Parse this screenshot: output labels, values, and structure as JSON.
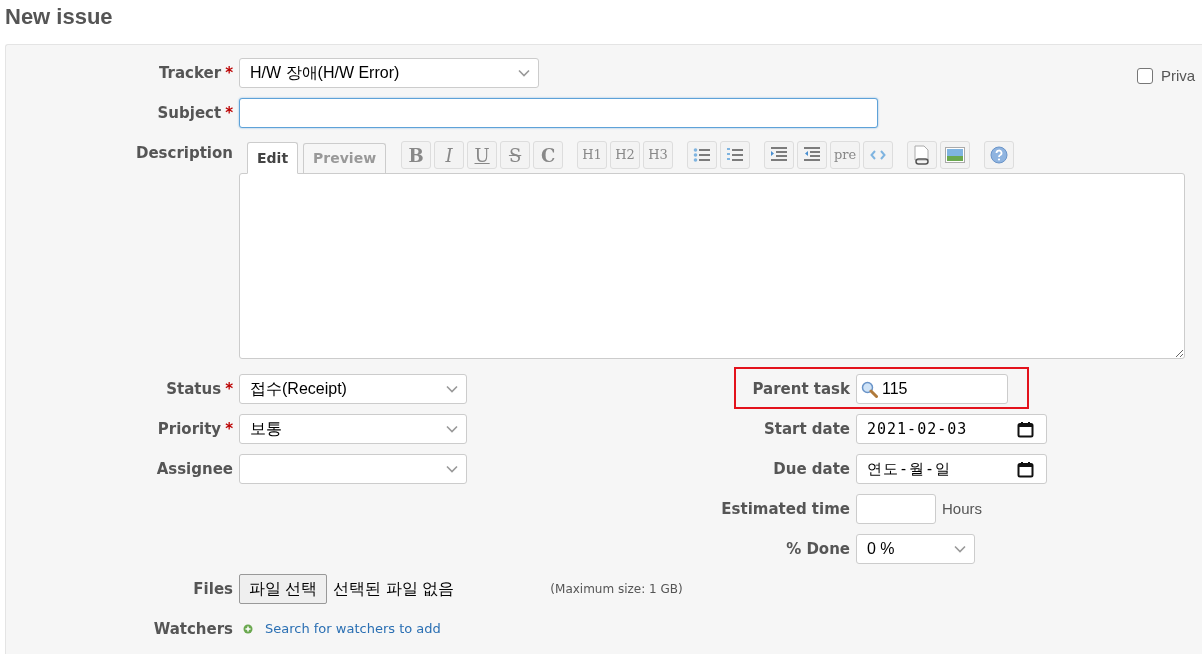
{
  "page_title": "New issue",
  "private": {
    "label": "Priva",
    "checked": false
  },
  "tracker": {
    "label": "Tracker",
    "required_mark": "*",
    "value": "H/W 장애(H/W Error)"
  },
  "subject": {
    "label": "Subject",
    "required_mark": "*",
    "focused": true
  },
  "description": {
    "label": "Description",
    "tabs": [
      {
        "label": "Edit",
        "selected": true
      },
      {
        "label": "Preview",
        "selected": false
      }
    ],
    "toolbar": [
      [
        {
          "kind": "text",
          "label": "B"
        },
        {
          "kind": "text",
          "label": "I"
        },
        {
          "kind": "text",
          "label": "U"
        },
        {
          "kind": "text",
          "label": "S"
        },
        {
          "kind": "text",
          "label": "C"
        }
      ],
      [
        {
          "kind": "text",
          "label": "H1"
        },
        {
          "kind": "text",
          "label": "H2"
        },
        {
          "kind": "text",
          "label": "H3"
        }
      ],
      [
        {
          "kind": "ul"
        },
        {
          "kind": "ol"
        }
      ],
      [
        {
          "kind": "indent"
        },
        {
          "kind": "outdent"
        },
        {
          "kind": "text",
          "label": "pre"
        },
        {
          "kind": "code"
        }
      ],
      [
        {
          "kind": "link"
        },
        {
          "kind": "image"
        }
      ],
      [
        {
          "kind": "help"
        }
      ]
    ]
  },
  "left_fields": [
    {
      "label": "Status",
      "required_mark": "*",
      "kind": "select",
      "value": "접수(Receipt)"
    },
    {
      "label": "Priority",
      "required_mark": "*",
      "kind": "select",
      "value": "보통"
    },
    {
      "label": "Assignee",
      "kind": "select"
    }
  ],
  "right_fields": [
    {
      "label": "Parent task",
      "kind": "search",
      "value": "115",
      "highlighted": true
    },
    {
      "label": "Start date",
      "kind": "date",
      "value": "2021-02-03",
      "highlighted": false
    },
    {
      "label": "Due date",
      "kind": "date",
      "value": "연도-월-일",
      "highlighted": false
    },
    {
      "label": "Estimated time",
      "kind": "hours",
      "unit": "Hours",
      "highlighted": false
    },
    {
      "label": "% Done",
      "kind": "select",
      "value": "0 %",
      "highlighted": false
    }
  ],
  "files": {
    "label": "Files",
    "button": "파일 선택",
    "status": "선택된 파일 없음",
    "note": "(Maximum size: 1 GB)"
  },
  "watchers": {
    "label": "Watchers",
    "link": "Search for watchers to add"
  }
}
